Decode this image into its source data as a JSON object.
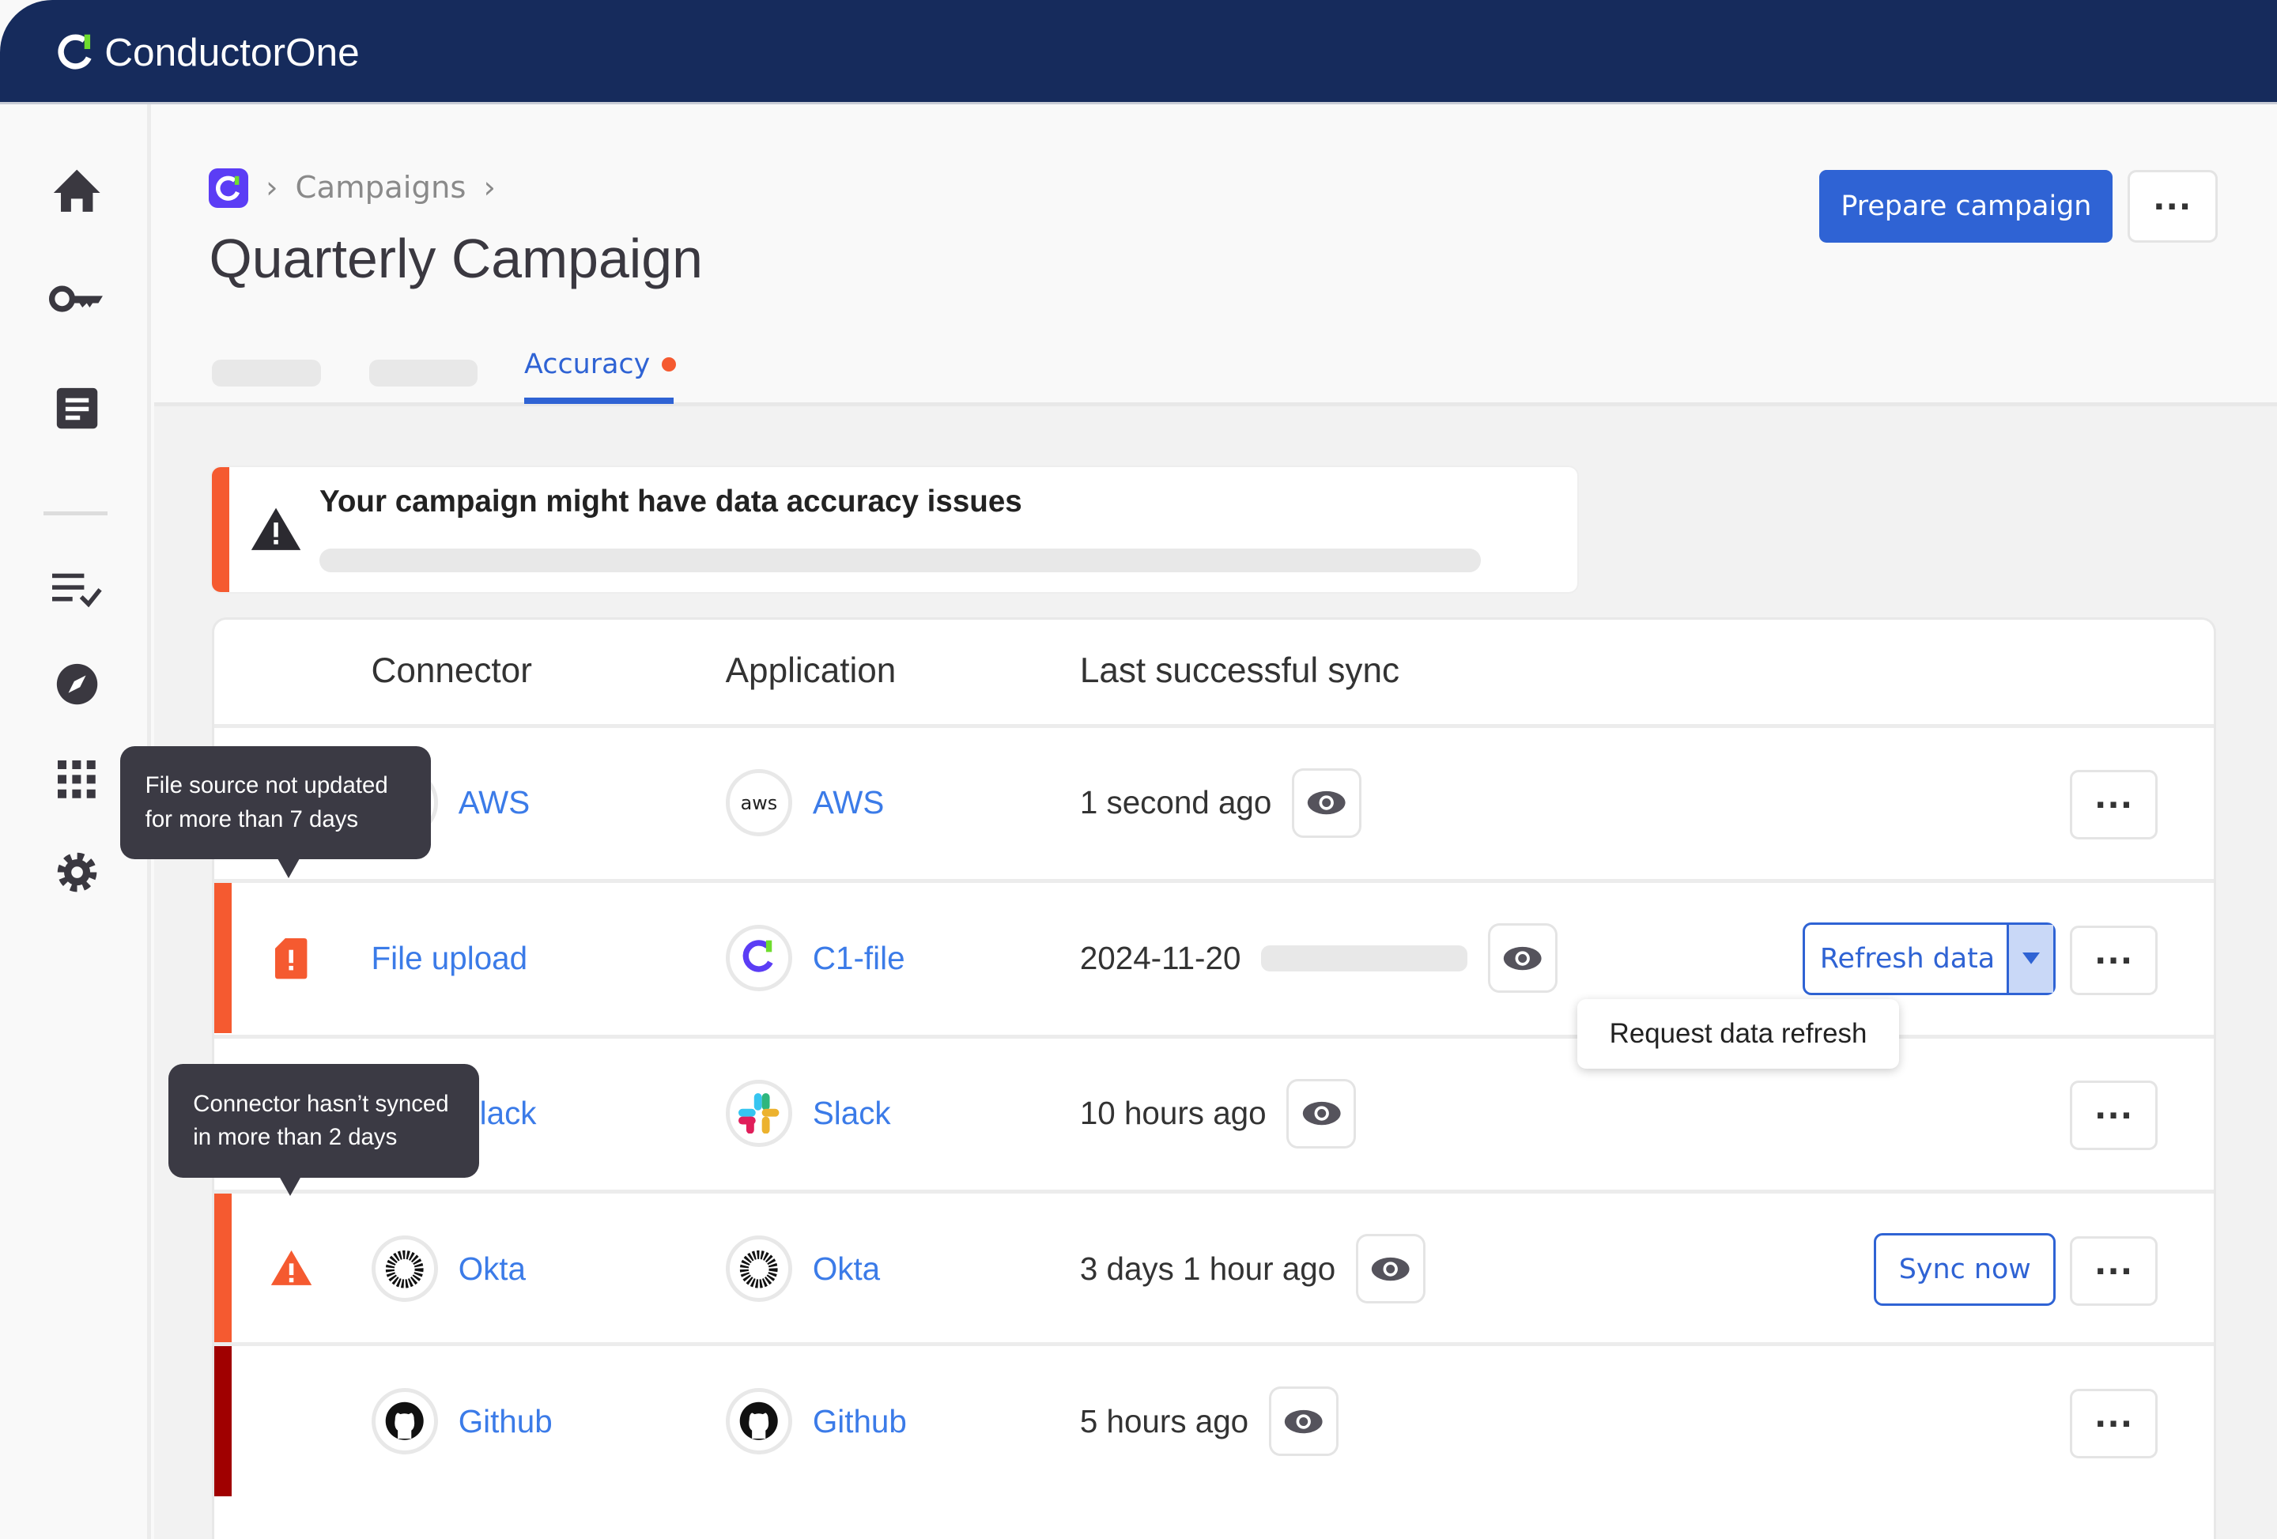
{
  "app": {
    "brand": "ConductorOne",
    "brand_colors": {
      "navy": "#162b5c",
      "accent": "#2f63d4",
      "warning": "#f55a30",
      "error": "#a00000"
    }
  },
  "sidebar": {
    "items": [
      {
        "icon": "home-icon"
      },
      {
        "icon": "key-icon"
      },
      {
        "icon": "document-icon"
      },
      {
        "icon": "checklist-icon"
      },
      {
        "icon": "compass-icon"
      },
      {
        "icon": "apps-grid-icon"
      },
      {
        "icon": "settings-icon"
      }
    ]
  },
  "header": {
    "breadcrumb": [
      "Campaigns"
    ],
    "title": "Quarterly Campaign",
    "prepare_label": "Prepare campaign",
    "more_label": "···"
  },
  "tabs": {
    "active": "Accuracy"
  },
  "alert": {
    "title": "Your campaign might have data accuracy issues"
  },
  "table": {
    "columns": [
      "Connector",
      "Application",
      "Last successful sync"
    ],
    "rows": [
      {
        "connector": "AWS",
        "application": "AWS",
        "sync": "1 second ago"
      },
      {
        "connector": "File upload",
        "application": "C1-file",
        "sync": "2024-11-20",
        "action": "Refresh data",
        "status": "warning"
      },
      {
        "connector": "Slack",
        "application": "Slack",
        "sync": "10 hours ago"
      },
      {
        "connector": "Okta",
        "application": "Okta",
        "sync": "3 days 1 hour ago",
        "action": "Sync now",
        "status": "warning"
      },
      {
        "connector": "Github",
        "application": "Github",
        "sync": "5 hours ago",
        "status": "error"
      }
    ],
    "more_label": "···"
  },
  "tooltips": {
    "file": "File source not updated for more than 7 days",
    "connector": "Connector hasn’t synced in more than 2 days"
  },
  "dropdown": {
    "item": "Request data refresh"
  }
}
